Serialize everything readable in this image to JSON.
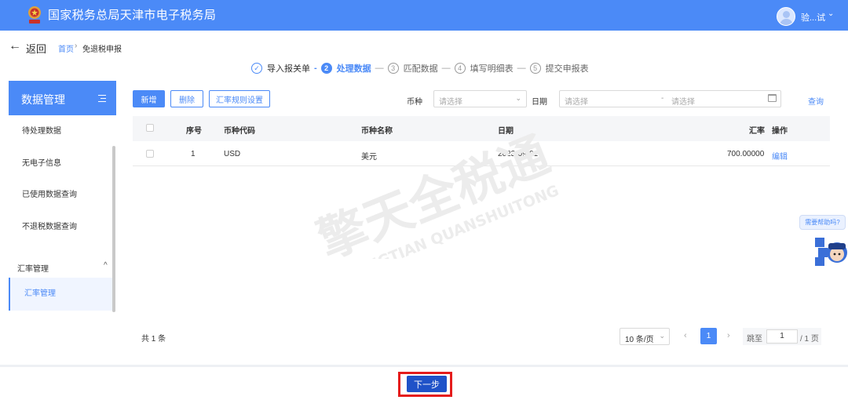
{
  "header": {
    "title": "国家税务总局天津市电子税务局",
    "user_name": "验...试",
    "user_caret": "⌄"
  },
  "nav": {
    "back_arrow": "←",
    "back_label": "返回",
    "breadcrumb_home": "首页",
    "breadcrumb_sep": "›",
    "breadcrumb_current": "免退税申报"
  },
  "steps": [
    {
      "num": "✓",
      "label": "导入报关单",
      "state": "done"
    },
    {
      "num": "2",
      "label": "处理数据",
      "state": "active"
    },
    {
      "num": "3",
      "label": "匹配数据",
      "state": "todo"
    },
    {
      "num": "4",
      "label": "填写明细表",
      "state": "todo"
    },
    {
      "num": "5",
      "label": "提交申报表",
      "state": "todo"
    }
  ],
  "step_seps": [
    "-",
    "—",
    "—",
    "—"
  ],
  "sidebar": {
    "title": "数据管理",
    "items": [
      "待处理数据",
      "无电子信息",
      "已使用数据查询",
      "不退税数据查询"
    ],
    "group_label": "汇率管理",
    "group_caret": "^",
    "active_item": "汇率管理"
  },
  "toolbar": {
    "add_label": "新增",
    "delete_label": "删除",
    "rule_label": "汇率规则设置",
    "currency_label": "币种",
    "currency_placeholder": "请选择",
    "date_label": "日期",
    "date_start_placeholder": "请选择",
    "date_sep": "-",
    "date_end_placeholder": "请选择",
    "query_label": "查询",
    "caret": "⌄"
  },
  "table": {
    "headers": {
      "seq": "序号",
      "code": "币种代码",
      "name": "币种名称",
      "date": "日期",
      "rate": "汇率",
      "action": "操作"
    },
    "rows": [
      {
        "seq": "1",
        "code": "USD",
        "name": "美元",
        "date": "2023-09-01",
        "rate": "700.00000",
        "action": "编辑"
      }
    ]
  },
  "pagination": {
    "total": "共 1 条",
    "page_size": "10 条/页",
    "prev": "‹",
    "current": "1",
    "next": "›",
    "jump_label": "跳至",
    "jump_value": "1",
    "jump_total": "/ 1 页"
  },
  "footer": {
    "next_label": "下一步"
  },
  "help": {
    "bubble": "需要帮助吗?"
  },
  "watermark": {
    "line1": "擎天全税通",
    "line2": "QINGTIAN QUANSHUITONG"
  },
  "colors": {
    "primary": "#4b8af7",
    "highlight_border": "#e51c1c",
    "next_button": "#1f52c8"
  }
}
